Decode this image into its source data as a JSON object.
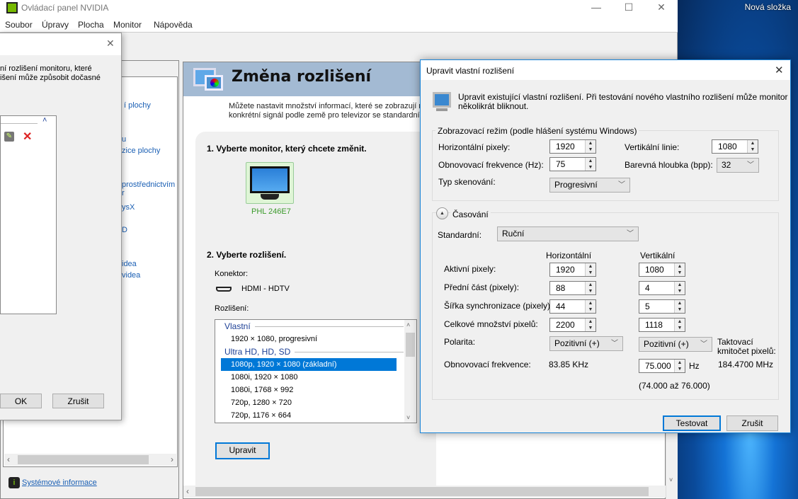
{
  "desktop": {
    "folder_label": "Nová složka"
  },
  "window": {
    "title": "Ovládací panel NVIDIA",
    "minimize": "—",
    "maximize": "☐",
    "close": "✕"
  },
  "menu": [
    "Soubor",
    "Úpravy",
    "Plocha",
    "Monitor",
    "Nápověda"
  ],
  "left_tree": {
    "links": [
      "í plochy",
      "u",
      "zice plochy",
      "prostřednictvím r",
      "ysX",
      "D",
      "idea",
      "videa"
    ],
    "sysinfo": "Systémové informace"
  },
  "small_dialog": {
    "text_line1": "ní rozlišení monitoru, které",
    "text_line2": "išení může způsobit dočasné",
    "ok": "OK",
    "cancel": "Zrušit"
  },
  "page": {
    "title": "Změna rozlišení",
    "desc_line1": "Můžete nastavit množství informací, které se zobrazují na",
    "desc_line2": "konkrétní signál podle země pro televizor se standardním",
    "step1": "1. Vyberte monitor, který chcete změnit.",
    "monitor_name": "PHL 246E7",
    "step2": "2. Vyberte rozlišení.",
    "connector_label": "Konektor:",
    "connector_value": "HDMI - HDTV",
    "resolution_label": "Rozlišení:",
    "list": {
      "group1": "Vlastní",
      "custom_item": "1920 × 1080, progresivní",
      "group2": "Ultra HD, HD, SD",
      "items": [
        "1080p, 1920 × 1080 (základní)",
        "1080i, 1920 × 1080",
        "1080i, 1768 × 992",
        "720p, 1280 × 720",
        "720p, 1176 × 664"
      ],
      "selected_index": 0
    },
    "edit_button": "Upravit"
  },
  "dialog": {
    "title": "Upravit vlastní rozlišení",
    "close": "✕",
    "info": "Upravit existující vlastní rozlišení. Při testování nového vlastního rozlišení může monitor",
    "info2": "několikrát bliknout.",
    "mode_group": "Zobrazovací režim (podle hlášení systému Windows)",
    "h_pixels_label": "Horizontální pixely:",
    "h_pixels": "1920",
    "v_lines_label": "Vertikální linie:",
    "v_lines": "1080",
    "refresh_label": "Obnovovací frekvence (Hz):",
    "refresh": "75",
    "depth_label": "Barevná hloubka (bpp):",
    "depth": "32",
    "scan_label": "Typ skenování:",
    "scan": "Progresivní",
    "timing_group": "Časování",
    "standard_label": "Standardní:",
    "standard": "Ruční",
    "col_h": "Horizontální",
    "col_v": "Vertikální",
    "rows": [
      {
        "label": "Aktivní pixely:",
        "h": "1920",
        "v": "1080"
      },
      {
        "label": "Přední část (pixely):",
        "h": "88",
        "v": "4"
      },
      {
        "label": "Šířka synchronizace (pixely):",
        "h": "44",
        "v": "5"
      },
      {
        "label": "Celkové množství pixelů:",
        "h": "2200",
        "v": "1118"
      }
    ],
    "polarity_label": "Polarita:",
    "polarity_h": "Pozitivní (+)",
    "polarity_v": "Pozitivní (+)",
    "clock_label1": "Taktovací",
    "clock_label2": "kmitočet pixelů:",
    "clock_value": "184.4700 MHz",
    "refresh2_label": "Obnovovací frekvence:",
    "h_freq": "83.85 KHz",
    "v_freq": "75.000",
    "hz": "Hz",
    "range": "(74.000 až 76.000)",
    "test": "Testovat",
    "cancel": "Zrušit"
  }
}
